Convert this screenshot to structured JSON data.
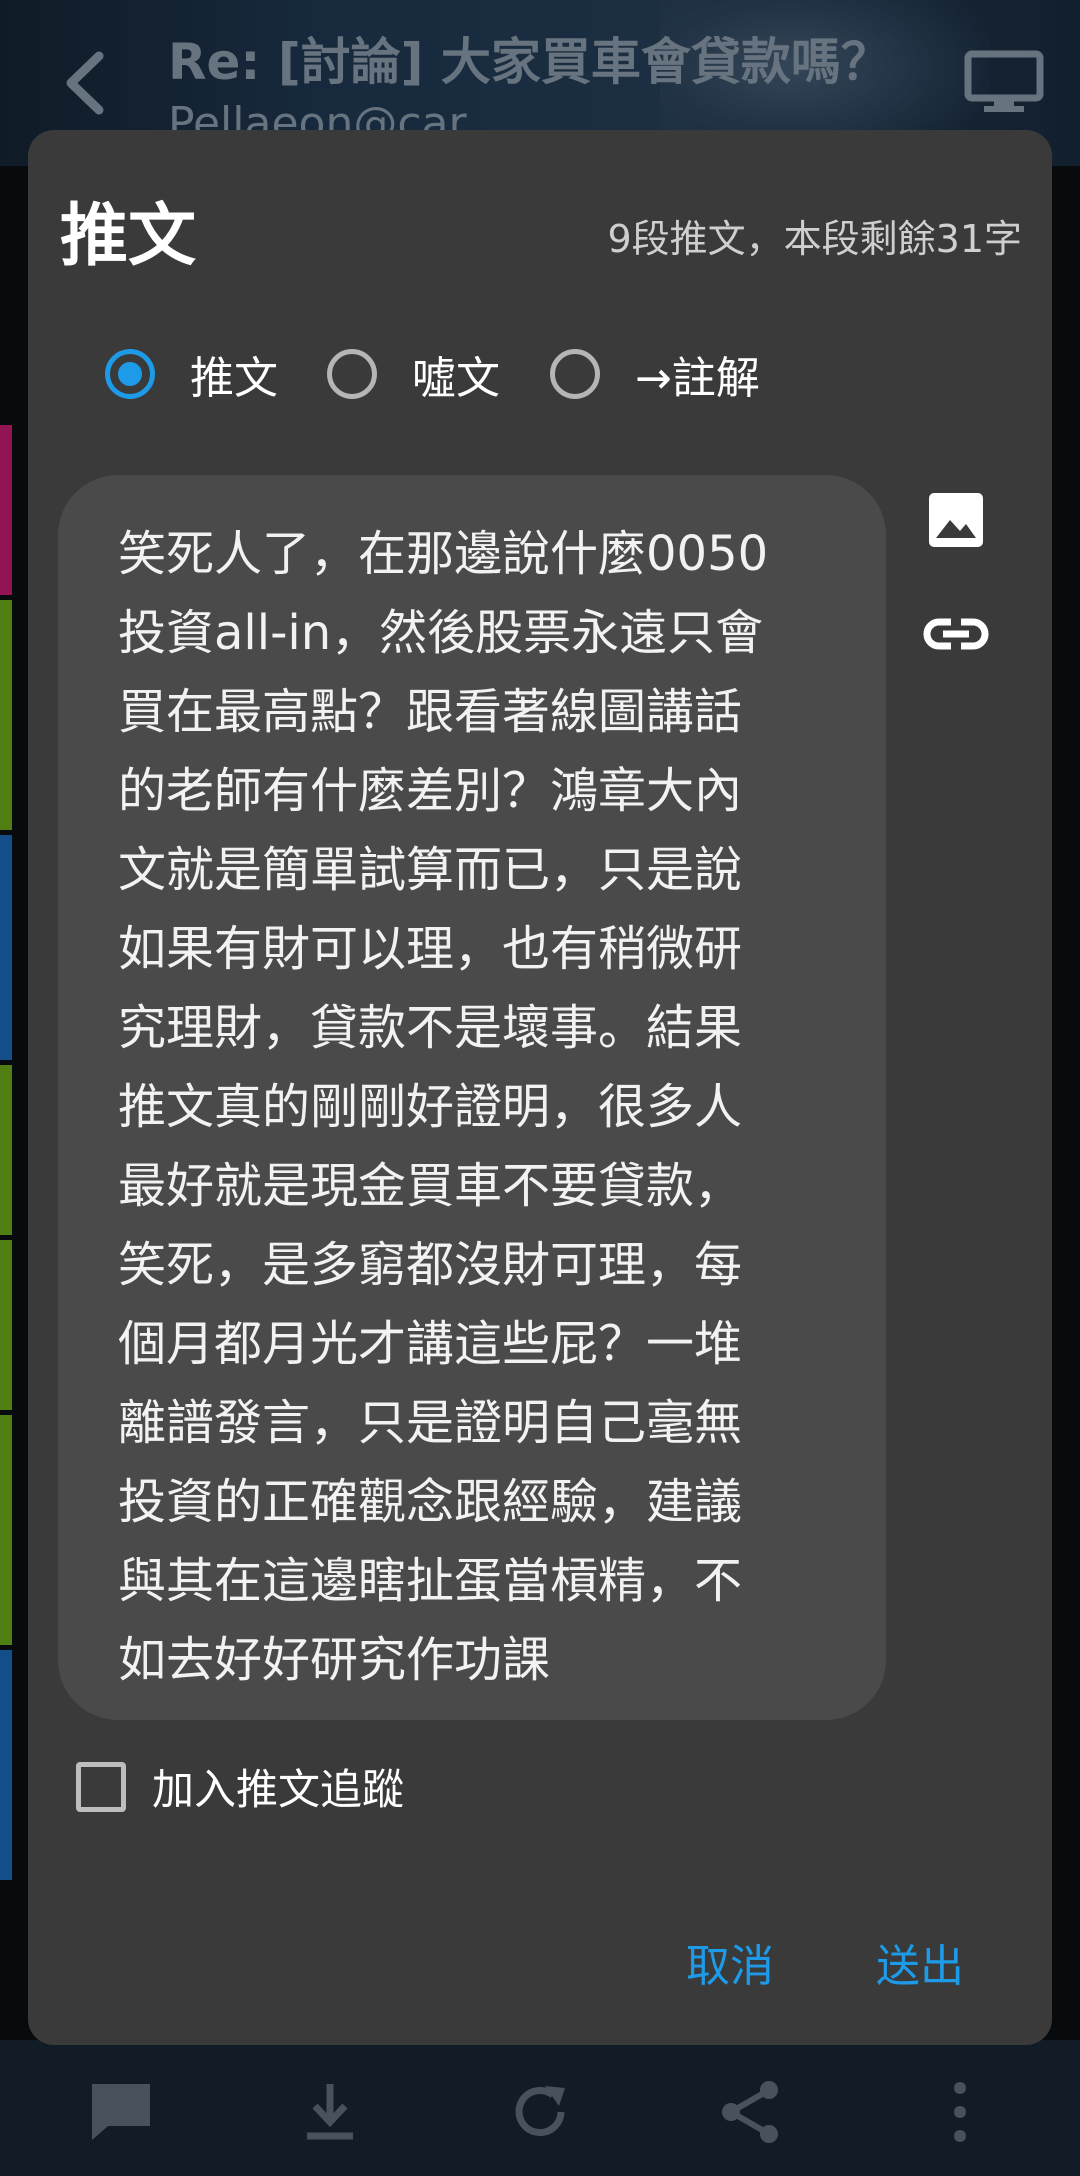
{
  "background": {
    "header_title": "Re: [討論] 大家買車會貸款嗎？",
    "header_subtitle": "Pellaeon@car",
    "stripe_colors": [
      "#e0207f",
      "#7cc21d",
      "#1f78d1",
      "#7cc21d",
      "#7cc21d",
      "#7cc21d",
      "#1f78d1"
    ],
    "bottom_icons": [
      "comment-icon",
      "download-icon",
      "refresh-icon",
      "share-icon",
      "more-vert-icon"
    ]
  },
  "dialog": {
    "title": "推文",
    "counter": "9段推文，本段剩餘31字",
    "options": [
      {
        "label": "推文",
        "checked": true
      },
      {
        "label": "噓文",
        "checked": false
      },
      {
        "label": "→註解",
        "checked": false
      }
    ],
    "comment_text": "笑死人了，在那邊說什麼0050\n投資all-in，然後股票永遠只會\n買在最高點？跟看著線圖講話\n的老師有什麼差別？鴻章大內\n文就是簡單試算而已，只是說\n如果有財可以理，也有稍微研\n究理財，貸款不是壞事。結果\n推文真的剛剛好證明，很多人\n最好就是現金買車不要貸款，\n笑死，是多窮都沒財可理，每\n個月都月光才講這些屁？一堆\n離譜發言，只是證明自己毫無\n投資的正確觀念跟經驗，建議\n與其在這邊瞎扯蛋當槓精，不\n如去好好研究作功課",
    "attach_icons": [
      "image-icon",
      "link-icon"
    ],
    "track_label": "加入推文追蹤",
    "track_checked": false,
    "cancel_label": "取消",
    "send_label": "送出"
  },
  "colors": {
    "accent": "#1e9be8",
    "dialog_bg": "#3a3a3a",
    "input_bg": "#4a4a4a"
  }
}
